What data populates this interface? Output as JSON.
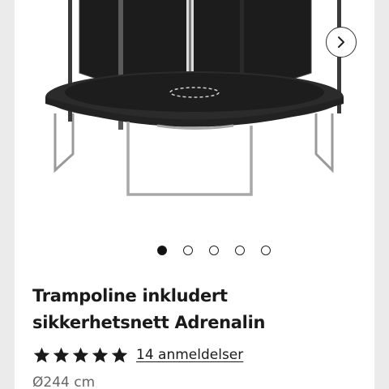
{
  "product": {
    "image_alt": "trampoline-with-safety-net",
    "title": "Trampoline inkludert sikkerhetsnett Adrenalin",
    "rating": 5,
    "rating_max": 5,
    "reviews_label": "14 anmeldelser",
    "spec": "Ø244 cm"
  },
  "gallery": {
    "total_images": 5,
    "active_index": 0,
    "next_icon": "chevron-right-icon"
  },
  "colors": {
    "text": "#1a1a1a",
    "muted": "#666666",
    "page_bg": "#ebebeb",
    "card_bg": "#ffffff"
  }
}
